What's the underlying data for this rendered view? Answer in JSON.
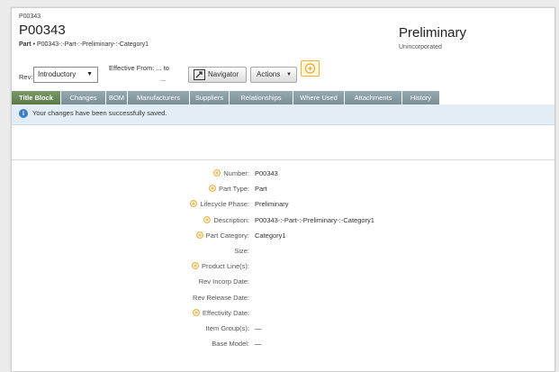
{
  "header": {
    "breadcrumb": "P00343",
    "title": "P00343",
    "subtitle_type": "Part",
    "subtitle_rest": "• P00343-:-Part-:-Preliminary-:-Category1",
    "status": "Preliminary",
    "status_sub": "Unincorporated"
  },
  "toolbar": {
    "rev_label": "Rev:",
    "rev_value": "Introductory",
    "effective_label": "Effective From: ... to",
    "effective_dots": "...",
    "navigator_label": "Navigator",
    "actions_label": "Actions"
  },
  "tabs": [
    {
      "label": "Title Block",
      "active": true
    },
    {
      "label": "Changes"
    },
    {
      "label": "BOM"
    },
    {
      "label": "Manufacturers"
    },
    {
      "label": "Suppliers"
    },
    {
      "label": "Relationships"
    },
    {
      "label": "Where Used"
    },
    {
      "label": "Attachments"
    },
    {
      "label": "History"
    }
  ],
  "message": "Your changes have been successfully saved.",
  "fields": [
    {
      "label": "Number:",
      "value": "P00343",
      "editable": true
    },
    {
      "label": "Part Type:",
      "value": "Part",
      "editable": true
    },
    {
      "label": "Lifecycle Phase:",
      "value": "Preliminary",
      "editable": true
    },
    {
      "label": "Description:",
      "value": "P00343-:-Part-:-Preliminary-:-Category1",
      "editable": true
    },
    {
      "label": "Part Category:",
      "value": "Category1",
      "editable": true
    },
    {
      "label": "Size:",
      "value": "",
      "editable": false
    },
    {
      "label": "Product Line(s):",
      "value": "",
      "editable": true
    },
    {
      "label": "Rev Incorp Date:",
      "value": "",
      "editable": false
    },
    {
      "label": "Rev Release Date:",
      "value": "",
      "editable": false
    },
    {
      "label": "Effectivity Date:",
      "value": "",
      "editable": true
    },
    {
      "label": "Item Group(s):",
      "value": "—",
      "editable": false
    },
    {
      "label": "Base Model:",
      "value": "—",
      "editable": false
    }
  ],
  "colors": {
    "tab": "#8a9ea5",
    "tab_active": "#6b8a57",
    "message_bg": "#e3edf5",
    "edit_icon": "#e6a92e"
  }
}
